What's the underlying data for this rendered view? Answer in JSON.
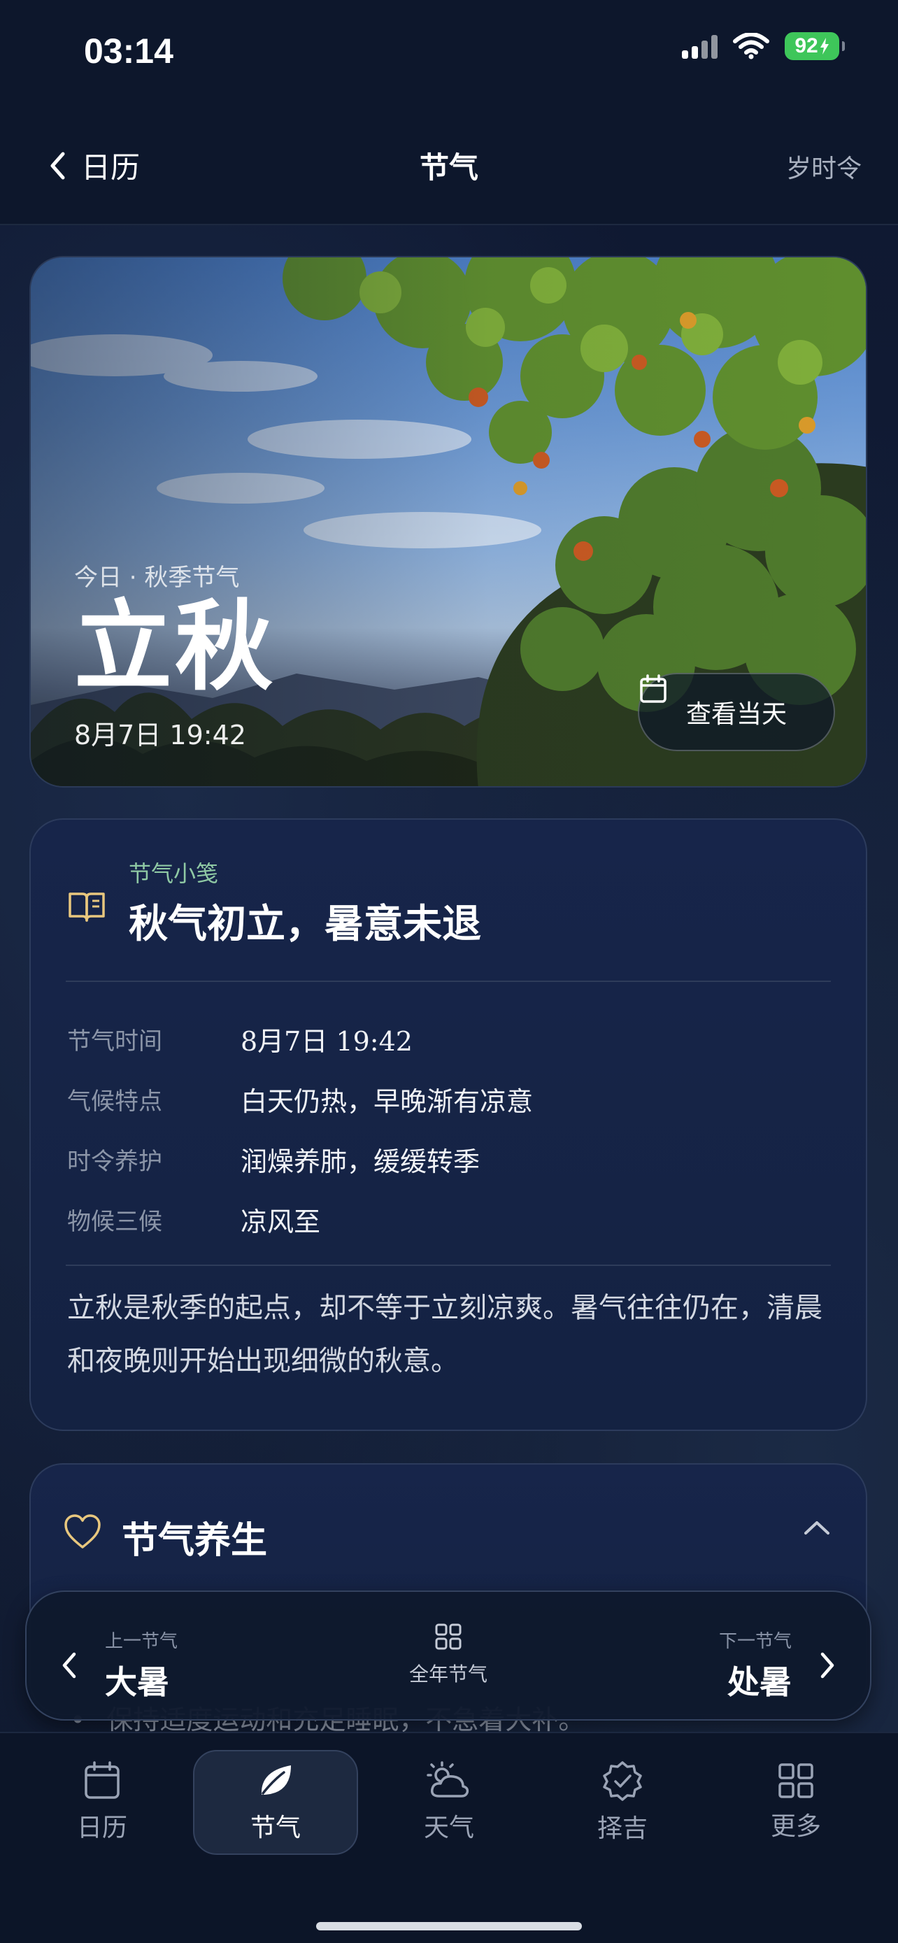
{
  "status": {
    "time": "03:14",
    "battery": "92"
  },
  "nav": {
    "back_label": "日历",
    "title": "节气",
    "right_label": "岁时令"
  },
  "hero": {
    "subtitle": "今日 · 秋季节气",
    "title": "立秋",
    "datetime": "8月7日 19:42",
    "button_label": "查看当天"
  },
  "tip": {
    "kicker": "节气小笺",
    "title": "秋气初立，暑意未退",
    "rows": [
      {
        "label": "节气时间",
        "value": "8月7日 19:42"
      },
      {
        "label": "气候特点",
        "value": "白天仍热，早晚渐有凉意"
      },
      {
        "label": "时令养护",
        "value": "润燥养肺，缓缓转季"
      },
      {
        "label": "物候三候",
        "value": "凉风至"
      }
    ],
    "paragraph": "立秋是秋季的起点，却不等于立刻凉爽。暑气往往仍在，清晨和夜晚则开始出现细微的秋意。"
  },
  "health": {
    "title": "节气养生",
    "bullet": "保持适度运动和充足睡眠，不急着大补。"
  },
  "term_nav": {
    "prev_small": "上一节气",
    "prev_name": "大暑",
    "center_label": "全年节气",
    "next_small": "下一节气",
    "next_name": "处暑"
  },
  "tabs": [
    {
      "label": "日历",
      "icon": "calendar-icon"
    },
    {
      "label": "节气",
      "icon": "leaf-icon",
      "active": true
    },
    {
      "label": "天气",
      "icon": "partly-cloudy-icon"
    },
    {
      "label": "择吉",
      "icon": "badge-check-icon"
    },
    {
      "label": "更多",
      "icon": "grid-icon"
    }
  ],
  "colors": {
    "accent_gold": "#e8c77e",
    "accent_green": "#8fc9a4",
    "battery_green": "#3ec65a"
  }
}
